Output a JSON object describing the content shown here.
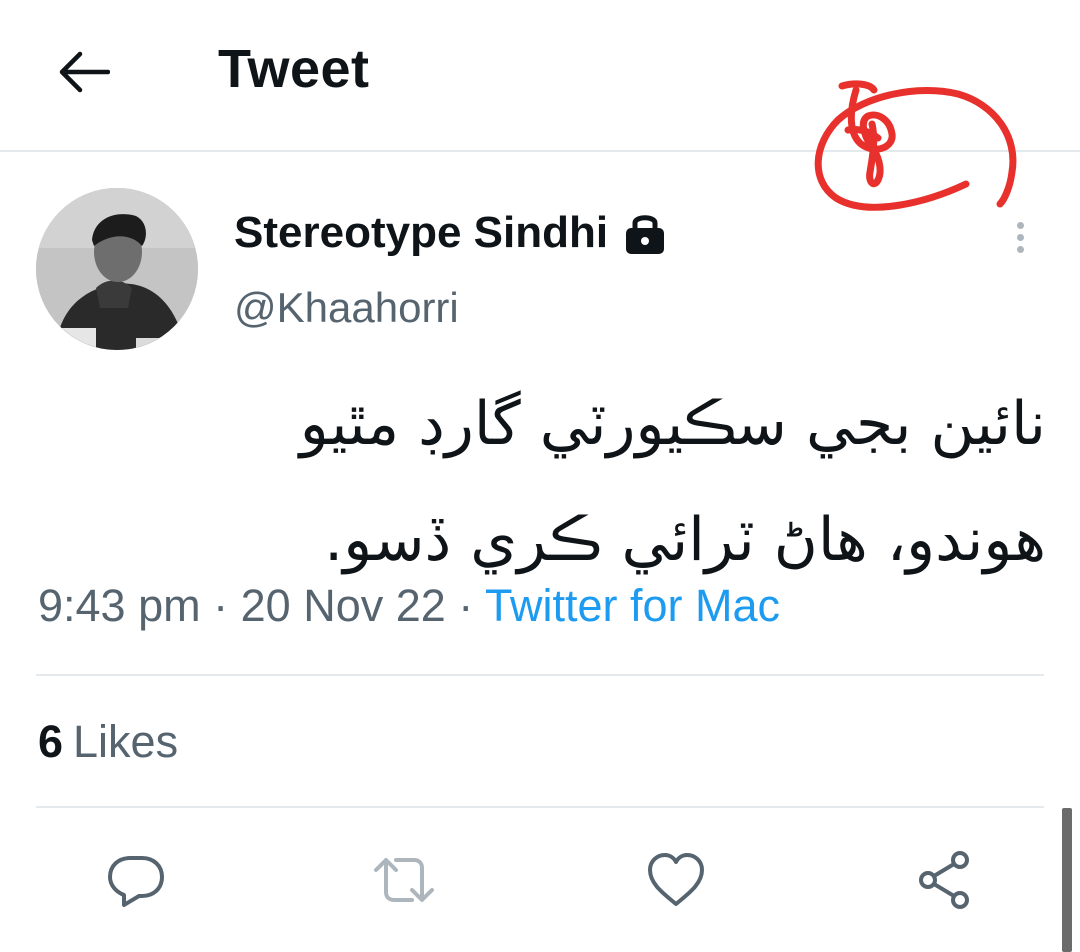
{
  "header": {
    "title": "Tweet",
    "back_icon": "arrow-left-icon"
  },
  "tweet": {
    "author": {
      "name": "Stereotype Sindhi",
      "handle": "@Khaahorri",
      "protected_icon": "lock-icon"
    },
    "text": "نائين بجي سڪيورٽي گارڊ مٿيو هوندو، هاڻ ٽرائي ڪري ڏسو.",
    "time": "9:43 pm",
    "separator": "·",
    "date": "20 Nov 22",
    "source": "Twitter for Mac",
    "likes": {
      "count": "6",
      "label": "Likes"
    }
  },
  "actions": {
    "reply_icon": "reply-icon",
    "retweet_icon": "retweet-icon",
    "like_icon": "heart-icon",
    "share_icon": "share-icon"
  },
  "colors": {
    "text_primary": "#0f1419",
    "text_secondary": "#566470",
    "accent": "#1d9bf0",
    "action_icon": "#566470",
    "divider": "#e3e9ec",
    "scribble": "#e8312c"
  }
}
